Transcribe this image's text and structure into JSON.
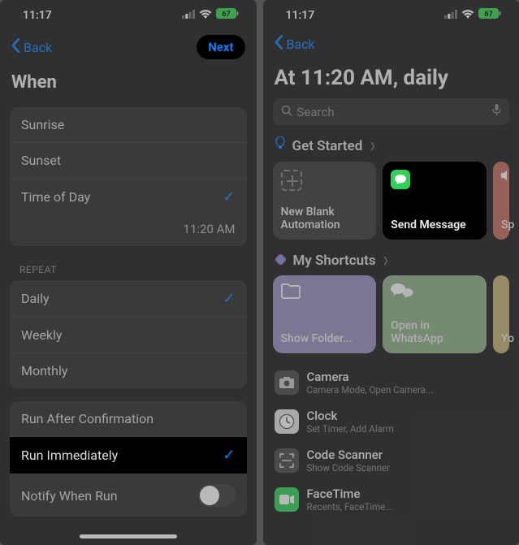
{
  "status": {
    "time": "11:17",
    "battery": "67"
  },
  "left": {
    "nav": {
      "back": "Back",
      "next": "Next"
    },
    "title": "When",
    "when_options": {
      "sunrise": "Sunrise",
      "sunset": "Sunset",
      "time_of_day": "Time of Day",
      "selected_time": "11:20 AM"
    },
    "repeat": {
      "label": "REPEAT",
      "daily": "Daily",
      "weekly": "Weekly",
      "monthly": "Monthly"
    },
    "run": {
      "after_confirm": "Run After Confirmation",
      "immediately": "Run Immediately",
      "notify": "Notify When Run"
    }
  },
  "right": {
    "nav": {
      "back": "Back"
    },
    "title": "At 11:20 AM, daily",
    "search_placeholder": "Search",
    "get_started": {
      "header": "Get Started"
    },
    "cards_top": {
      "new_blank": "New Blank Automation",
      "send_message": "Send Message",
      "sp": "Sp"
    },
    "my_shortcuts": {
      "header": "My Shortcuts"
    },
    "cards_mid": {
      "show_folder": "Show Folder...",
      "open_whatsapp": "Open in WhatsApp",
      "yo": "Yo"
    },
    "apps": {
      "camera": {
        "name": "Camera",
        "sub": "Camera Mode, Open Camera..."
      },
      "clock": {
        "name": "Clock",
        "sub": "Set Timer, Add Alarm"
      },
      "scanner": {
        "name": "Code Scanner",
        "sub": "Show Code Scanner"
      },
      "facetime": {
        "name": "FaceTime",
        "sub": "Recents, FaceTime..."
      }
    }
  }
}
